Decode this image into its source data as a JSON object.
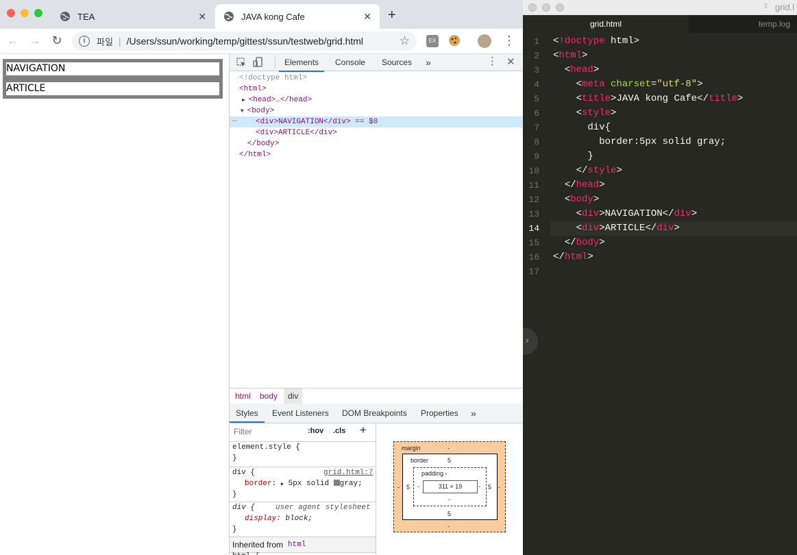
{
  "browser": {
    "tabs": [
      {
        "title": "TEA",
        "close": "✕"
      },
      {
        "title": "JAVA kong Cafe",
        "close": "✕"
      }
    ],
    "new_tab": "+",
    "toolbar": {
      "back": "←",
      "forward": "→",
      "reload": "↻",
      "scheme_label": "파일",
      "url": "/Users/ssun/working/temp/gittest/ssun/testweb/grid.html",
      "bookmark": "☆",
      "ext_label": "EX",
      "menu": "⋮"
    }
  },
  "page": {
    "divs": [
      "NAVIGATION",
      "ARTICLE"
    ]
  },
  "devtools": {
    "tabs": [
      "Elements",
      "Console",
      "Sources",
      "»"
    ],
    "dom_lines": [
      "<!doctype html>",
      "<html>",
      "<head>…</head>",
      "<body>",
      "<div>NAVIGATION</div> == $0",
      "<div>ARTICLE</div>",
      "</body>",
      "</html>"
    ],
    "breadcrumbs": [
      "html",
      "body",
      "div"
    ],
    "styles_tabs": [
      "Styles",
      "Event Listeners",
      "DOM Breakpoints",
      "Properties",
      "»"
    ],
    "filter_placeholder": "Filter",
    "hov": ":hov",
    "cls": ".cls",
    "plus": "+",
    "rules": {
      "element_style": "element.style {",
      "close_brace": "}",
      "div_selector": "div {",
      "div_source": "grid.html:7",
      "border_prop": "border",
      "border_value": "5px solid",
      "color_name": "gray;",
      "ua_selector": "div {",
      "ua_source": "user agent stylesheet",
      "display_prop": "display",
      "display_value": "block;",
      "inherited": "Inherited from",
      "inherited_tag": "html",
      "partial": "html {"
    },
    "box_model": {
      "margin_label": "margin",
      "margin_value": "-",
      "border_label": "border",
      "border_value": "5",
      "padding_label": "padding -",
      "content": "311 × 19",
      "side_value": "5",
      "dash": "-"
    }
  },
  "editor": {
    "title": "grid.l",
    "tabs": [
      "grid.html",
      "temp.log"
    ],
    "line_numbers": [
      "1",
      "2",
      "3",
      "4",
      "5",
      "6",
      "7",
      "8",
      "9",
      "10",
      "11",
      "12",
      "13",
      "14",
      "15",
      "16",
      "17"
    ],
    "code": [
      "<!doctype html>",
      "<html>",
      "  <head>",
      "    <meta charset=\"utf-8\">",
      "    <title>JAVA kong Cafe</title>",
      "    <style>",
      "      div{",
      "        border:5px solid gray;",
      "      }",
      "    </style>",
      "  </head>",
      "  <body>",
      "    <div>NAVIGATION</div>",
      "    <div>ARTICLE</div>",
      "  </body>",
      "</html>",
      ""
    ]
  },
  "colors": {
    "accent": "#1a73e8",
    "editor_bg": "#272822",
    "tag_pink": "#f92672",
    "attr_green": "#a6e22e",
    "string_yellow": "#e6db74",
    "margin_orange": "#f9cc9d"
  }
}
